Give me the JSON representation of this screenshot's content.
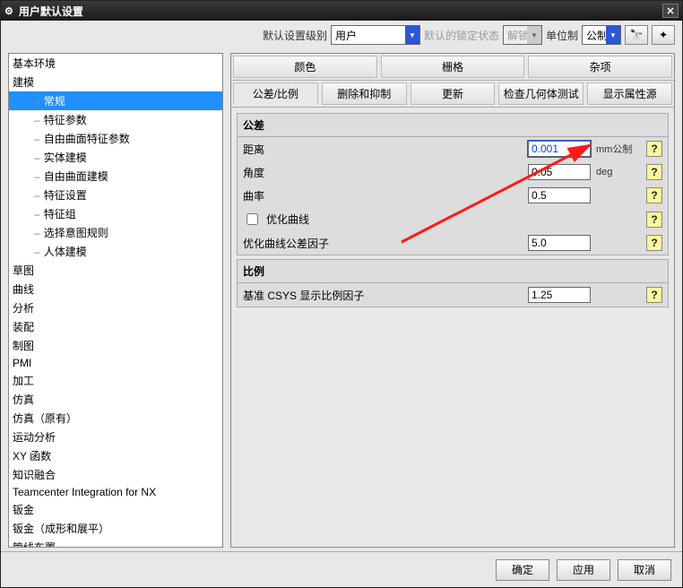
{
  "window": {
    "title": "用户默认设置"
  },
  "toolbar": {
    "level_label": "默认设置级别",
    "level_value": "用户",
    "lock_label": "默认的锁定状态",
    "lock_value": "解锁",
    "unit_label": "单位制",
    "unit_value": "公制"
  },
  "tree": {
    "items": [
      {
        "label": "基本环境",
        "type": "root"
      },
      {
        "label": "建模",
        "type": "root"
      },
      {
        "label": "常规",
        "type": "child",
        "selected": true
      },
      {
        "label": "特征参数",
        "type": "child"
      },
      {
        "label": "自由曲面特征参数",
        "type": "child"
      },
      {
        "label": "实体建模",
        "type": "child"
      },
      {
        "label": "自由曲面建模",
        "type": "child"
      },
      {
        "label": "特征设置",
        "type": "child"
      },
      {
        "label": "特征组",
        "type": "child"
      },
      {
        "label": "选择意图规则",
        "type": "child"
      },
      {
        "label": "人体建模",
        "type": "child"
      },
      {
        "label": "草图",
        "type": "root"
      },
      {
        "label": "曲线",
        "type": "root"
      },
      {
        "label": "分析",
        "type": "root"
      },
      {
        "label": "装配",
        "type": "root"
      },
      {
        "label": "制图",
        "type": "root"
      },
      {
        "label": "PMI",
        "type": "root"
      },
      {
        "label": "加工",
        "type": "root"
      },
      {
        "label": "仿真",
        "type": "root"
      },
      {
        "label": "仿真（原有）",
        "type": "root"
      },
      {
        "label": "运动分析",
        "type": "root"
      },
      {
        "label": "XY 函数",
        "type": "root"
      },
      {
        "label": "知识融合",
        "type": "root"
      },
      {
        "label": "Teamcenter Integration for NX",
        "type": "root"
      },
      {
        "label": "钣金",
        "type": "root"
      },
      {
        "label": "钣金（成形和展平）",
        "type": "root"
      },
      {
        "label": "管线布置",
        "type": "root"
      }
    ]
  },
  "topTabs": [
    "颜色",
    "栅格",
    "杂项"
  ],
  "subTabs": [
    "公差/比例",
    "删除和抑制",
    "更新",
    "检查几何体测试",
    "显示属性源"
  ],
  "subTabActive": 0,
  "group1": {
    "title": "公差",
    "rows": [
      {
        "label": "距离",
        "value": "0.001",
        "unit": "mm公制",
        "highlight": true
      },
      {
        "label": "角度",
        "value": "0.05",
        "unit": "deg"
      },
      {
        "label": "曲率",
        "value": "0.5",
        "unit": ""
      }
    ],
    "checkbox": {
      "label": "优化曲线",
      "checked": false
    },
    "row_opt": {
      "label": "优化曲线公差因子",
      "value": "5.0"
    }
  },
  "group2": {
    "title": "比例",
    "row": {
      "label": "基准 CSYS 显示比例因子",
      "value": "1.25"
    }
  },
  "footer": {
    "ok": "确定",
    "apply": "应用",
    "cancel": "取消"
  },
  "icons": {
    "gear": "⚙",
    "close": "✕",
    "binoc": "🔭",
    "wand": "✦",
    "help": "?"
  }
}
